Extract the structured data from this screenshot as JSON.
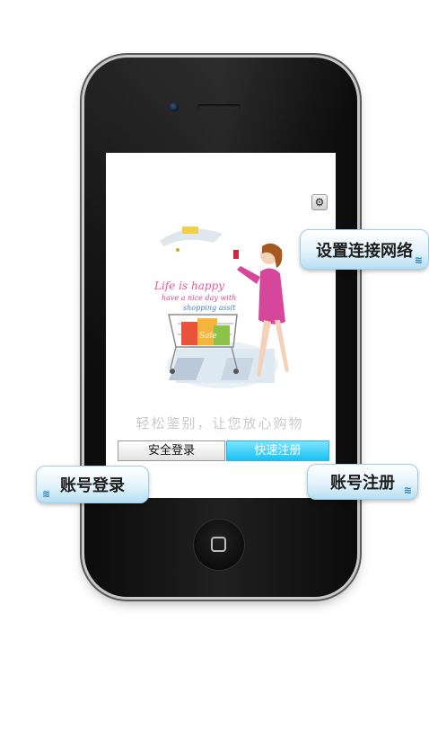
{
  "screen": {
    "slogan": "轻松鉴别，让您放心购物",
    "login_button": "安全登录",
    "register_button": "快速注册",
    "settings_icon": "gear-icon"
  },
  "illustration": {
    "line1": "Life is happy",
    "line2": "have a nice day with",
    "line3": "shopping assit",
    "sale_tag": "Sale"
  },
  "callouts": {
    "network": "设置连接网络",
    "login": "账号登录",
    "register": "账号注册"
  },
  "colors": {
    "register_accent": "#18c2f4",
    "bubble_blue": "#b7def2"
  }
}
